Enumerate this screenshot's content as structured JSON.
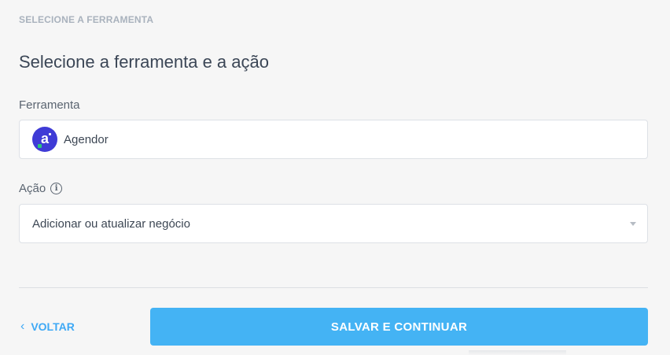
{
  "section": {
    "eyebrow": "SELECIONE A FERRAMENTA",
    "title": "Selecione a ferramenta e a ação"
  },
  "tool_field": {
    "label": "Ferramenta",
    "value": "Agendor",
    "logo_letter": "a",
    "logo_color": "#3f3bd6"
  },
  "action_field": {
    "label": "Ação",
    "value": "Adicionar ou atualizar negócio",
    "info_icon_glyph": "i"
  },
  "footer": {
    "back_label": "VOLTAR",
    "back_icon_glyph": "‹",
    "submit_label": "SALVAR E CONTINUAR"
  },
  "colors": {
    "accent": "#44b3f4",
    "link": "#3fa9f5"
  }
}
